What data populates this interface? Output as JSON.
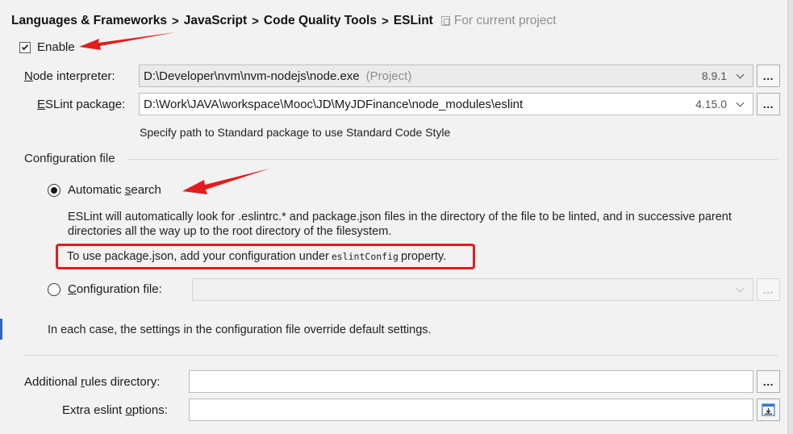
{
  "breadcrumb": {
    "items": [
      "Languages & Frameworks",
      "JavaScript",
      "Code Quality Tools",
      "ESLint"
    ],
    "separator": ">",
    "scope": "For current project"
  },
  "enable": {
    "label": "Enable",
    "checked": true
  },
  "node_interpreter": {
    "label_prefix": "N",
    "label_rest": "ode interpreter:",
    "value": "D:\\Developer\\nvm\\nvm-nodejs\\node.exe",
    "suffix": "(Project)",
    "version": "8.9.1",
    "browse": "..."
  },
  "eslint_package": {
    "label_prefix": "E",
    "label_rest": "SLint package:",
    "value": "D:\\Work\\JAVA\\workspace\\Mooc\\JD\\MyJDFinance\\node_modules\\eslint",
    "version": "4.15.0",
    "browse": "..."
  },
  "standard_hint": "Specify path to Standard package to use Standard Code Style",
  "config": {
    "section_title": "Configuration file",
    "automatic": {
      "label_before": "Automatic ",
      "label_u": "s",
      "label_after": "earch",
      "selected": true
    },
    "description_line1": "ESLint will automatically look for .eslintrc.* and package.json files in the directory of the file to be linted, and in successive parent",
    "description_line2": "directories all the way up to the root directory of the filesystem.",
    "note_before": "To use package.json, add your configuration under",
    "note_code": "eslintConfig",
    "note_after": "property.",
    "config_file": {
      "label_u": "C",
      "label_rest": "onfiguration file:",
      "selected": false,
      "value": "",
      "browse": "..."
    },
    "footer": "In each case, the settings in the configuration file override default settings."
  },
  "additional_rules": {
    "label_before": "Additional ",
    "label_u": "r",
    "label_after": "ules directory:",
    "value": "",
    "browse": "..."
  },
  "extra_options": {
    "label_before": "Extra eslint ",
    "label_u": "o",
    "label_after": "ptions:",
    "value": ""
  },
  "colors": {
    "annotation_red": "#e21d1d",
    "accent_blue": "#2e63c7"
  }
}
